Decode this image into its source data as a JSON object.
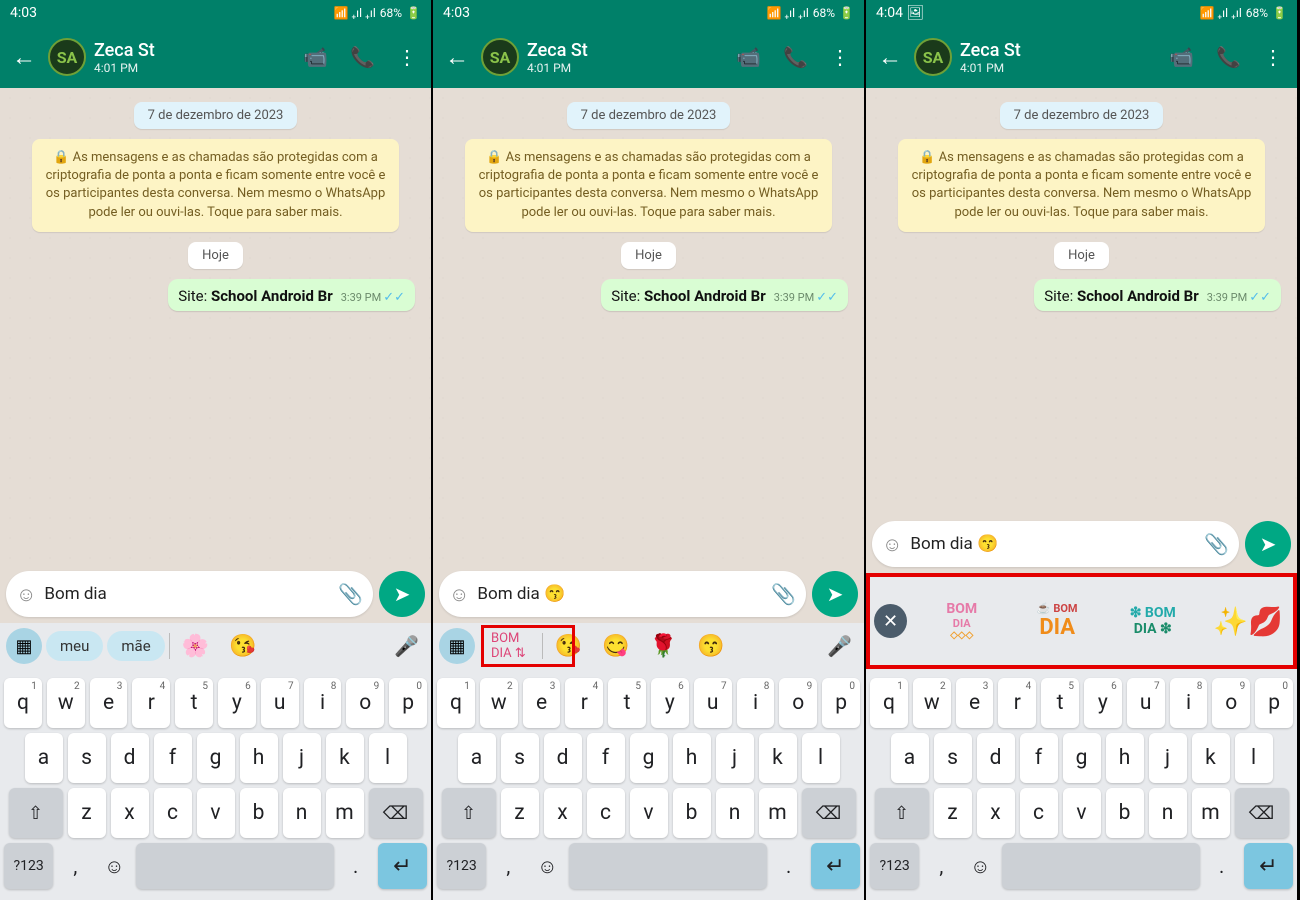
{
  "panes": [
    {
      "status": {
        "time": "4:03",
        "battery": "68%"
      },
      "contact": {
        "name": "Zeca St",
        "sub": "4:01 PM",
        "avatar": "SA"
      },
      "date_chip": "7 de dezembro de 2023",
      "encryption": "🔒 As mensagens e as chamadas são protegidas com a criptografia de ponta a ponta e ficam somente entre você e os participantes desta conversa. Nem mesmo o WhatsApp pode ler ou ouvi-las. Toque para saber mais.",
      "today_chip": "Hoje",
      "message": {
        "prefix": "Site: ",
        "bold": "School Android Br",
        "time": "3:39 PM"
      },
      "input": "Bom dia",
      "suggestions": {
        "type": "words",
        "w1": "meu",
        "w2": "mãe",
        "emojis": [
          "🌸",
          "😘"
        ]
      }
    },
    {
      "status": {
        "time": "4:03",
        "battery": "68%"
      },
      "contact": {
        "name": "Zeca St",
        "sub": "4:01 PM",
        "avatar": "SA"
      },
      "date_chip": "7 de dezembro de 2023",
      "encryption": "🔒 As mensagens e as chamadas são protegidas com a criptografia de ponta a ponta e ficam somente entre você e os participantes desta conversa. Nem mesmo o WhatsApp pode ler ou ouvi-las. Toque para saber mais.",
      "today_chip": "Hoje",
      "message": {
        "prefix": "Site: ",
        "bold": "School Android Br",
        "time": "3:39 PM"
      },
      "input": "Bom dia 😙",
      "suggestions": {
        "type": "emojis",
        "emojis": [
          "😘",
          "😋",
          "🌹",
          "😙"
        ]
      }
    },
    {
      "status": {
        "time": "4:04",
        "battery": "68%"
      },
      "contact": {
        "name": "Zeca St",
        "sub": "4:01 PM",
        "avatar": "SA"
      },
      "date_chip": "7 de dezembro de 2023",
      "encryption": "🔒 As mensagens e as chamadas são protegidas com a criptografia de ponta a ponta e ficam somente entre você e os participantes desta conversa. Nem mesmo o WhatsApp pode ler ou ouvi-las. Toque para saber mais.",
      "today_chip": "Hoje",
      "message": {
        "prefix": "Site: ",
        "bold": "School Android Br",
        "time": "3:39 PM"
      },
      "input": "Bom dia 😙",
      "stickers": [
        "BOM DIA",
        "BOM DIA",
        "BOM DIA",
        "✨"
      ]
    }
  ],
  "keyboard": {
    "r1": [
      [
        "q",
        "1"
      ],
      [
        "w",
        "2"
      ],
      [
        "e",
        "3"
      ],
      [
        "r",
        "4"
      ],
      [
        "t",
        "5"
      ],
      [
        "y",
        "6"
      ],
      [
        "u",
        "7"
      ],
      [
        "i",
        "8"
      ],
      [
        "o",
        "9"
      ],
      [
        "p",
        "0"
      ]
    ],
    "r2": [
      "a",
      "s",
      "d",
      "f",
      "g",
      "h",
      "j",
      "k",
      "l"
    ],
    "r3": [
      "z",
      "x",
      "c",
      "v",
      "b",
      "n",
      "m"
    ],
    "sym": "?123"
  }
}
